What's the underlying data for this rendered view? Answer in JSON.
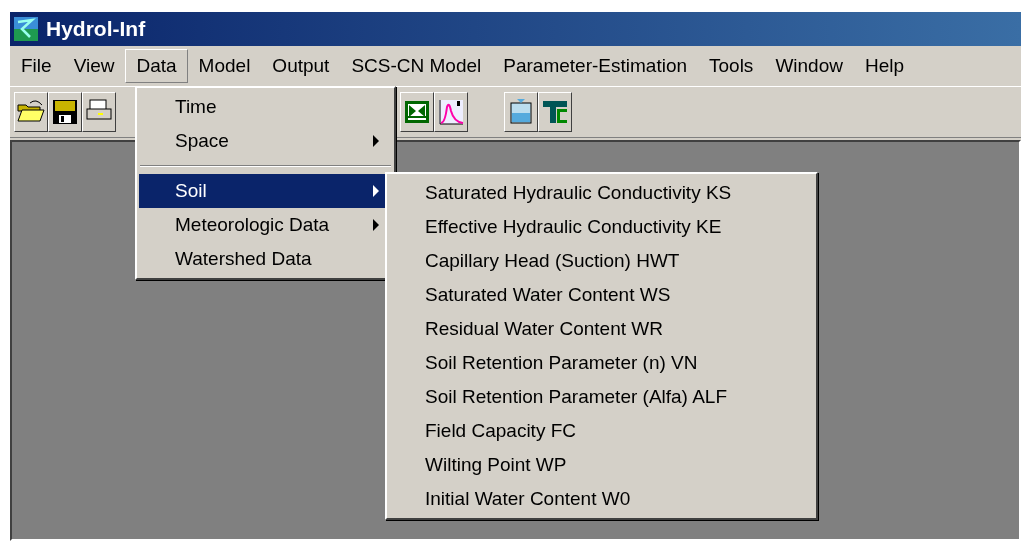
{
  "window": {
    "title": "Hydrol-Inf"
  },
  "menu_bar": [
    {
      "label": "File",
      "selected": false
    },
    {
      "label": "View",
      "selected": false
    },
    {
      "label": "Data",
      "selected": true
    },
    {
      "label": "Model",
      "selected": false
    },
    {
      "label": "Output",
      "selected": false
    },
    {
      "label": "SCS-CN Model",
      "selected": false
    },
    {
      "label": "Parameter-Estimation",
      "selected": false
    },
    {
      "label": "Tools",
      "selected": false
    },
    {
      "label": "Window",
      "selected": false
    },
    {
      "label": "Help",
      "selected": false
    }
  ],
  "data_menu": [
    {
      "kind": "item",
      "label": "Time",
      "has_submenu": false,
      "selected": false
    },
    {
      "kind": "item",
      "label": "Space",
      "has_submenu": true,
      "selected": false
    },
    {
      "kind": "separator"
    },
    {
      "kind": "item",
      "label": "Soil",
      "has_submenu": true,
      "selected": true
    },
    {
      "kind": "item",
      "label": "Meteorologic Data",
      "has_submenu": true,
      "selected": false
    },
    {
      "kind": "item",
      "label": "Watershed Data",
      "has_submenu": false,
      "selected": false
    }
  ],
  "soil_submenu": [
    {
      "label": "Saturated Hydraulic Conductivity KS",
      "selected": false
    },
    {
      "label": "Effective Hydraulic Conductivity KE",
      "selected": false
    },
    {
      "label": "Capillary Head (Suction) HWT",
      "selected": false
    },
    {
      "label": "Saturated Water Content WS",
      "selected": false
    },
    {
      "label": "Residual Water Content WR",
      "selected": false
    },
    {
      "label": "Soil Retention Parameter (n) VN",
      "selected": false
    },
    {
      "label": "Soil Retention Parameter (Alfa) ALF",
      "selected": false
    },
    {
      "label": "Field Capacity FC",
      "selected": false
    },
    {
      "label": "Wilting Point WP",
      "selected": false
    },
    {
      "label": "Initial Water Content W0",
      "selected": false
    }
  ]
}
